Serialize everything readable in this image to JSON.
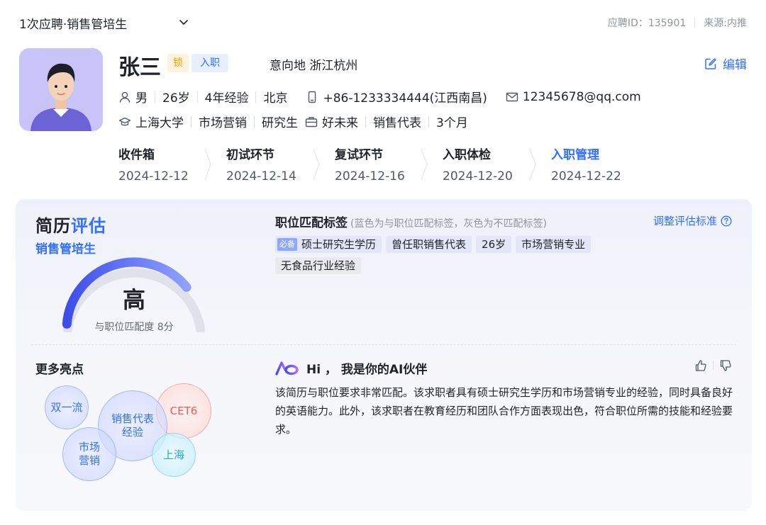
{
  "header": {
    "title": "1次应聘·销售管培生",
    "application_id": "应聘ID：135901",
    "source": "来源:内推"
  },
  "candidate": {
    "name": "张三",
    "badge_lock": "锁",
    "badge_status": "入职",
    "intent_location": "意向地 浙江杭州",
    "edit_label": "编辑",
    "gender": "男",
    "age": "26岁",
    "experience": "4年经验",
    "city": "北京",
    "phone": "+86-1233334444(江西南昌)",
    "email": "12345678@qq.com",
    "school": "上海大学",
    "major": "市场营销",
    "degree": "研究生",
    "company": "好未来",
    "position": "销售代表",
    "duration": "3个月"
  },
  "stages": [
    {
      "title": "收件箱",
      "date": "2024-12-12"
    },
    {
      "title": "初试环节",
      "date": "2024-12-14"
    },
    {
      "title": "复试环节",
      "date": "2024-12-16"
    },
    {
      "title": "入职体检",
      "date": "2024-12-20"
    },
    {
      "title": "入职管理",
      "date": "2024-12-22"
    }
  ],
  "evaluation": {
    "title_part1": "简历",
    "title_part2": "评估",
    "job": "销售管培生",
    "level": "高",
    "score_text": "与职位匹配度 8分",
    "score": 8,
    "score_max": 10
  },
  "tags": {
    "title": "职位匹配标签",
    "note": "(蓝色为与职位匹配标签，灰色为不匹配标签)",
    "adjust_label": "调整评估标准",
    "must_label": "必备",
    "matched": [
      "硕士研究生学历",
      "曾任职销售代表",
      "26岁",
      "市场营销专业"
    ],
    "unmatched": [
      "无食品行业经验"
    ]
  },
  "highlights": {
    "title": "更多亮点",
    "items": [
      "双一流",
      "销售代表经验",
      "CET6",
      "市场营销",
      "上海"
    ]
  },
  "ai": {
    "title": "Hi ， 我是你的AI伙伴",
    "text": "该简历与职位要求非常匹配。该求职者具有硕士研究生学历和市场营销专业的经验，同时具备良好的英语能力。此外，该求职者在教育经历和团队合作方面表现出色，符合职位所需的技能和经验要求。"
  },
  "colors": {
    "accent": "#3370ff",
    "lock": "#f5a200",
    "cet": "#f25a4d",
    "shanghai": "#22a7d6"
  }
}
